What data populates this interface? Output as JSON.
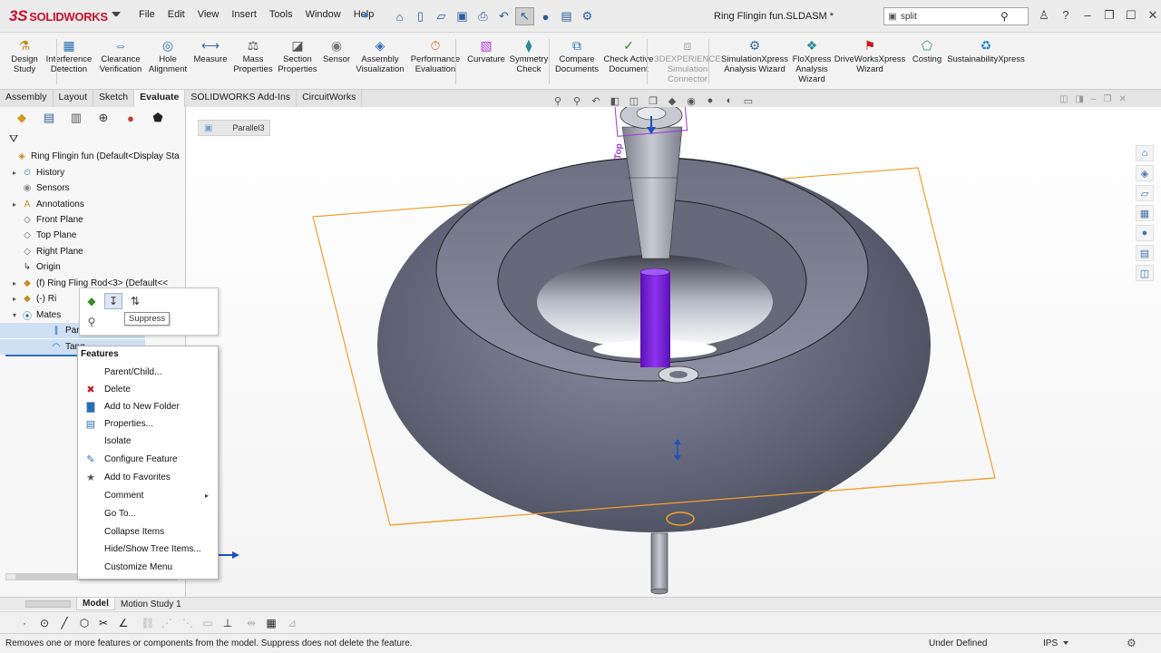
{
  "app": {
    "logo_prefix": "3S",
    "logo_name": "SOLIDWORKS"
  },
  "menu": [
    "File",
    "Edit",
    "View",
    "Insert",
    "Tools",
    "Window",
    "Help"
  ],
  "document_title": "Ring Flingin fun.SLDASM *",
  "search": {
    "value": "split"
  },
  "ribbon": [
    {
      "line1": "Design",
      "line2": "Study",
      "disabled": false
    },
    {
      "line1": "Interference",
      "line2": "Detection",
      "disabled": false
    },
    {
      "line1": "Clearance",
      "line2": "Verification",
      "disabled": false
    },
    {
      "line1": "Hole",
      "line2": "Alignment",
      "disabled": false
    },
    {
      "line1": "Measure",
      "line2": "",
      "disabled": false
    },
    {
      "line1": "Mass",
      "line2": "Properties",
      "disabled": false
    },
    {
      "line1": "Section",
      "line2": "Properties",
      "disabled": false
    },
    {
      "line1": "Sensor",
      "line2": "",
      "disabled": false
    },
    {
      "line1": "Assembly",
      "line2": "Visualization",
      "disabled": false
    },
    {
      "line1": "Performance",
      "line2": "Evaluation",
      "disabled": false
    },
    {
      "line1": "Curvature",
      "line2": "",
      "disabled": false
    },
    {
      "line1": "Symmetry",
      "line2": "Check",
      "disabled": false
    },
    {
      "line1": "Compare",
      "line2": "Documents",
      "disabled": false
    },
    {
      "line1": "Check Active",
      "line2": "Document",
      "disabled": false
    },
    {
      "line1": "3DEXPERIENCE",
      "line2": "Simulation",
      "line3": "Connector",
      "disabled": true
    },
    {
      "line1": "SimulationXpress",
      "line2": "Analysis Wizard",
      "disabled": false
    },
    {
      "line1": "FloXpress",
      "line2": "Analysis",
      "line3": "Wizard",
      "disabled": false
    },
    {
      "line1": "DriveWorksXpress",
      "line2": "Wizard",
      "disabled": false
    },
    {
      "line1": "Costing",
      "line2": "",
      "disabled": false
    },
    {
      "line1": "SustainabilityXpress",
      "line2": "",
      "disabled": false
    }
  ],
  "tabs": [
    "Assembly",
    "Layout",
    "Sketch",
    "Evaluate",
    "SOLIDWORKS Add-Ins",
    "CircuitWorks"
  ],
  "active_tab": "Evaluate",
  "tree": {
    "root": "Ring Flingin fun  (Default<Display Sta",
    "items": [
      "History",
      "Sensors",
      "Annotations",
      "Front Plane",
      "Top Plane",
      "Right Plane",
      "Origin",
      "(f) Ring Fling Rod<3> (Default<<",
      "(-) Ri",
      "Mates",
      "Paral",
      "Tang"
    ]
  },
  "breadcrumb": "Parallel3",
  "tooltip": "Suppress",
  "context_menu": {
    "header": "Features",
    "items": [
      "Parent/Child...",
      "Delete",
      "Add to New Folder",
      "Properties...",
      "Isolate",
      "Configure Feature",
      "Add to Favorites",
      "Comment",
      "Go To...",
      "Collapse Items",
      "Hide/Show Tree Items...",
      "Customize Menu"
    ]
  },
  "viewport": {
    "plane_label": "Top"
  },
  "bottom_tabs": [
    "Model",
    "Motion Study 1"
  ],
  "status": {
    "message": "Removes one or more features or components from the model. Suppress does not delete the feature.",
    "state": "Under Defined",
    "units": "IPS"
  },
  "colors": {
    "accent": "#c8102e",
    "plane_outline": "#f0a030",
    "rod_highlight": "#7a1fd6",
    "body": "#5d6172"
  }
}
